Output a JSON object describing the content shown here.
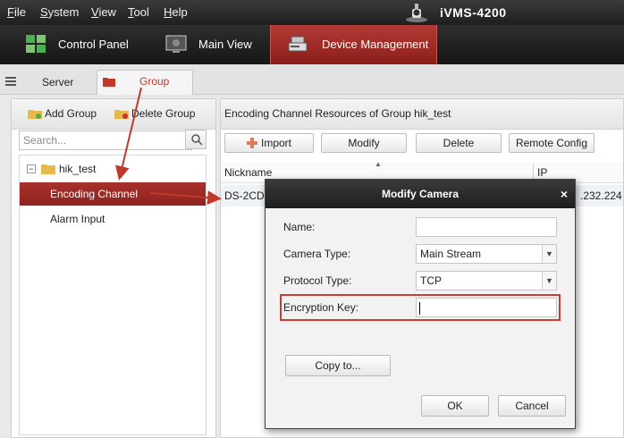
{
  "menubar": {
    "items": [
      "File",
      "System",
      "View",
      "Tool",
      "Help"
    ],
    "mnemonics": [
      "F",
      "S",
      "V",
      "T",
      "H"
    ],
    "rest": [
      "ile",
      "ystem",
      "iew",
      "ool",
      "elp"
    ],
    "app_title": "iVMS-4200"
  },
  "toptabs": [
    {
      "label": "Control Panel",
      "icon": "grid-icon"
    },
    {
      "label": "Main View",
      "icon": "monitor-icon"
    },
    {
      "label": "Device Management",
      "icon": "device-icon"
    }
  ],
  "subtabs": {
    "server": "Server",
    "group": "Group"
  },
  "left": {
    "add_group": "Add Group",
    "delete_group": "Delete Group",
    "search_placeholder": "Search...",
    "tree": {
      "root": "hik_test",
      "children": [
        "Encoding Channel",
        "Alarm Input"
      ]
    }
  },
  "right": {
    "title": "Encoding Channel Resources of Group hik_test",
    "buttons": {
      "import": "Import",
      "modify": "Modify",
      "delete": "Delete",
      "remote_config": "Remote Config"
    },
    "columns": {
      "nickname": "Nickname",
      "ip": "IP"
    },
    "row": {
      "nickname": "DS-2CD",
      "ip": ".232.224"
    }
  },
  "modal": {
    "title": "Modify Camera",
    "close": "×",
    "fields": {
      "name_label": "Name:",
      "name_value": "",
      "camera_type_label": "Camera Type:",
      "camera_type_value": "Main Stream",
      "protocol_type_label": "Protocol Type:",
      "protocol_type_value": "TCP",
      "encryption_key_label": "Encryption Key:",
      "encryption_key_value": ""
    },
    "copy_to": "Copy to...",
    "ok": "OK",
    "cancel": "Cancel"
  },
  "colors": {
    "accent": "#a8302b",
    "highlight": "#d03a35"
  }
}
